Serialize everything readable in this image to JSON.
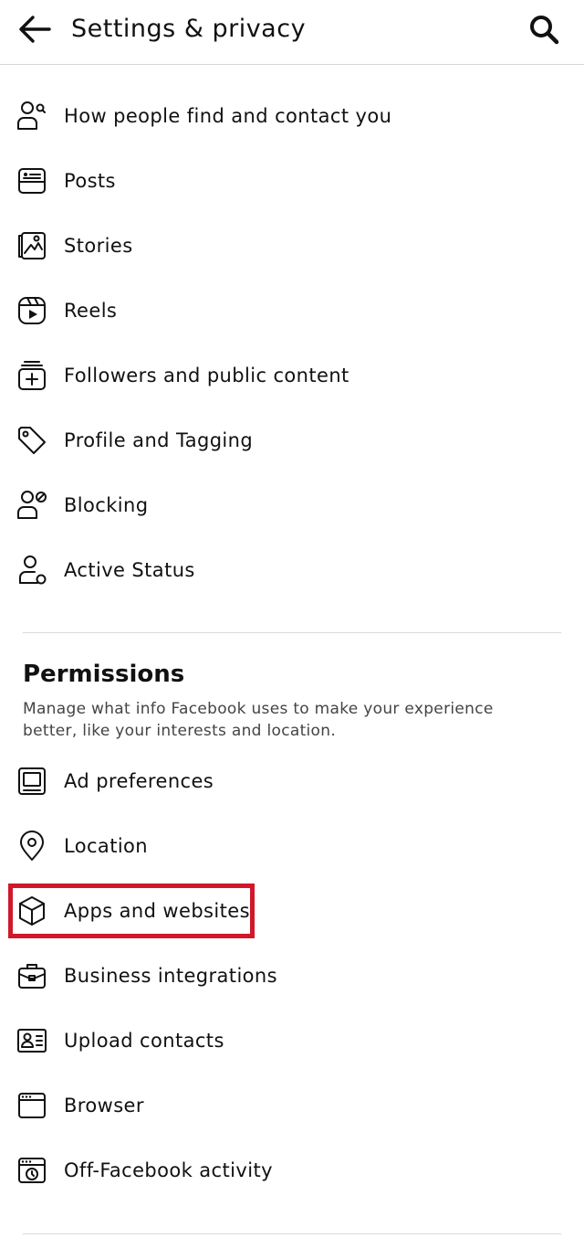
{
  "header": {
    "title": "Settings & privacy"
  },
  "items_top": [
    {
      "label": "How people find and contact you",
      "icon": "contact-icon"
    },
    {
      "label": "Posts",
      "icon": "posts-icon"
    },
    {
      "label": "Stories",
      "icon": "stories-icon"
    },
    {
      "label": "Reels",
      "icon": "reels-icon"
    },
    {
      "label": "Followers and public content",
      "icon": "followers-icon"
    },
    {
      "label": "Profile and Tagging",
      "icon": "tag-icon"
    },
    {
      "label": "Blocking",
      "icon": "blocking-icon"
    },
    {
      "label": "Active Status",
      "icon": "active-status-icon"
    }
  ],
  "permissions": {
    "title": "Permissions",
    "description": "Manage what info Facebook uses to make your experience better, like your interests and location.",
    "items": [
      {
        "label": "Ad preferences",
        "icon": "ad-preferences-icon"
      },
      {
        "label": "Location",
        "icon": "location-pin-icon"
      },
      {
        "label": "Apps and websites",
        "icon": "cube-icon"
      },
      {
        "label": "Business integrations",
        "icon": "briefcase-icon"
      },
      {
        "label": "Upload contacts",
        "icon": "contact-card-icon"
      },
      {
        "label": "Browser",
        "icon": "browser-icon"
      },
      {
        "label": "Off-Facebook activity",
        "icon": "history-browser-icon"
      }
    ]
  },
  "colors": {
    "highlight": "#d0182a",
    "divider": "#d9d9d9"
  }
}
